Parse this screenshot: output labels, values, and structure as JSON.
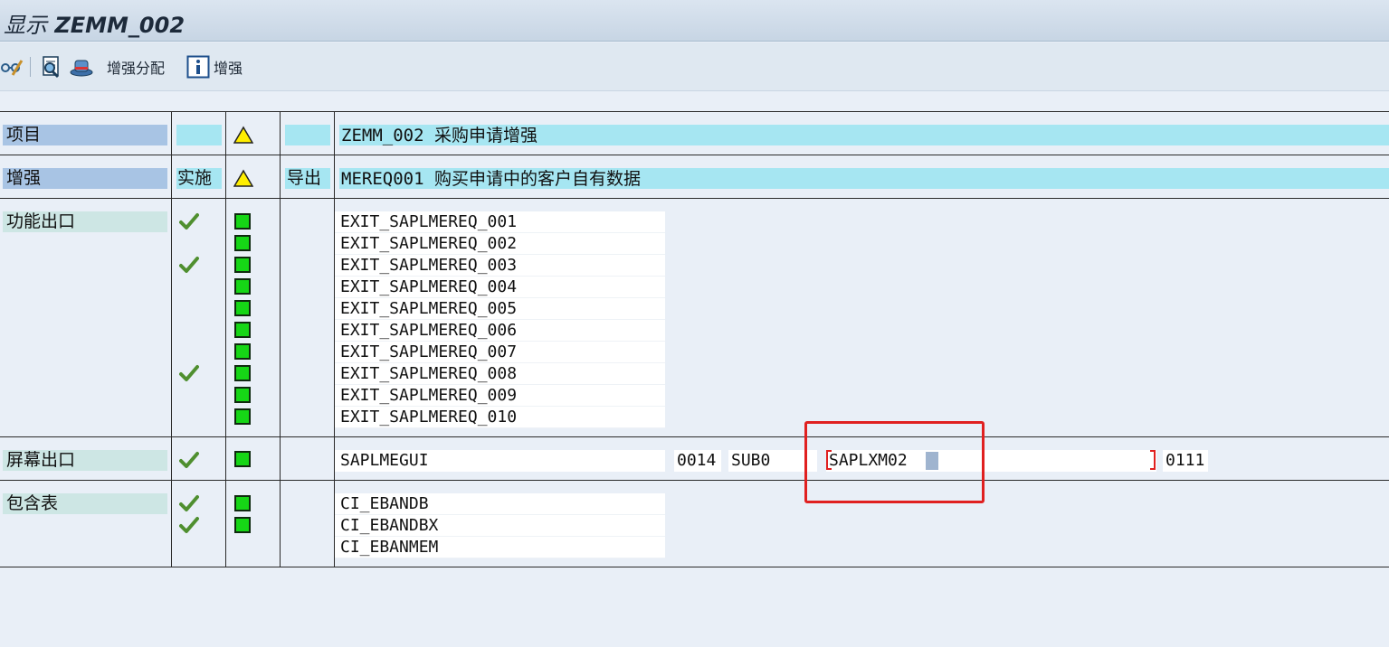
{
  "window": {
    "title_prefix": "显示",
    "title_code": "ZEMM_002"
  },
  "toolbar": {
    "items": [
      {
        "icon": "glasses-icon"
      },
      {
        "icon": "find-object-icon"
      },
      {
        "icon": "hat-icon"
      },
      {
        "icon": "none",
        "label": "增强分配"
      },
      {
        "icon": "info-icon",
        "label": "增强"
      }
    ]
  },
  "rows": {
    "project": {
      "label": "项目",
      "value": "ZEMM_002 采购申请增强"
    },
    "enhancement": {
      "label": "增强",
      "impl_label": "实施",
      "export_label": "导出",
      "value": "MEREQ001 购买申请中的客户自有数据"
    },
    "function_exits": {
      "label": "功能出口",
      "items": [
        {
          "name": "EXIT_SAPLMEREQ_001",
          "implemented": true
        },
        {
          "name": "EXIT_SAPLMEREQ_002",
          "implemented": false
        },
        {
          "name": "EXIT_SAPLMEREQ_003",
          "implemented": true
        },
        {
          "name": "EXIT_SAPLMEREQ_004",
          "implemented": false
        },
        {
          "name": "EXIT_SAPLMEREQ_005",
          "implemented": false
        },
        {
          "name": "EXIT_SAPLMEREQ_006",
          "implemented": false
        },
        {
          "name": "EXIT_SAPLMEREQ_007",
          "implemented": false
        },
        {
          "name": "EXIT_SAPLMEREQ_008",
          "implemented": true
        },
        {
          "name": "EXIT_SAPLMEREQ_009",
          "implemented": false
        },
        {
          "name": "EXIT_SAPLMEREQ_010",
          "implemented": false
        }
      ]
    },
    "screen_exits": {
      "label": "屏幕出口",
      "program": "SAPLMEGUI",
      "screen_no": "0014",
      "subarea": "SUB0",
      "called_program": "SAPLXM02",
      "called_screen": "0111"
    },
    "include_tables": {
      "label": "包含表",
      "items": [
        {
          "name": "CI_EBANDB",
          "implemented": true
        },
        {
          "name": "CI_EBANDBX",
          "implemented": true
        },
        {
          "name": "CI_EBANMEM",
          "implemented": false
        }
      ]
    }
  },
  "colors": {
    "status_green": "#16d616",
    "warning_yellow": "#ffee00",
    "highlight_red": "#e02020",
    "header_cyan": "#a6e6f2"
  }
}
